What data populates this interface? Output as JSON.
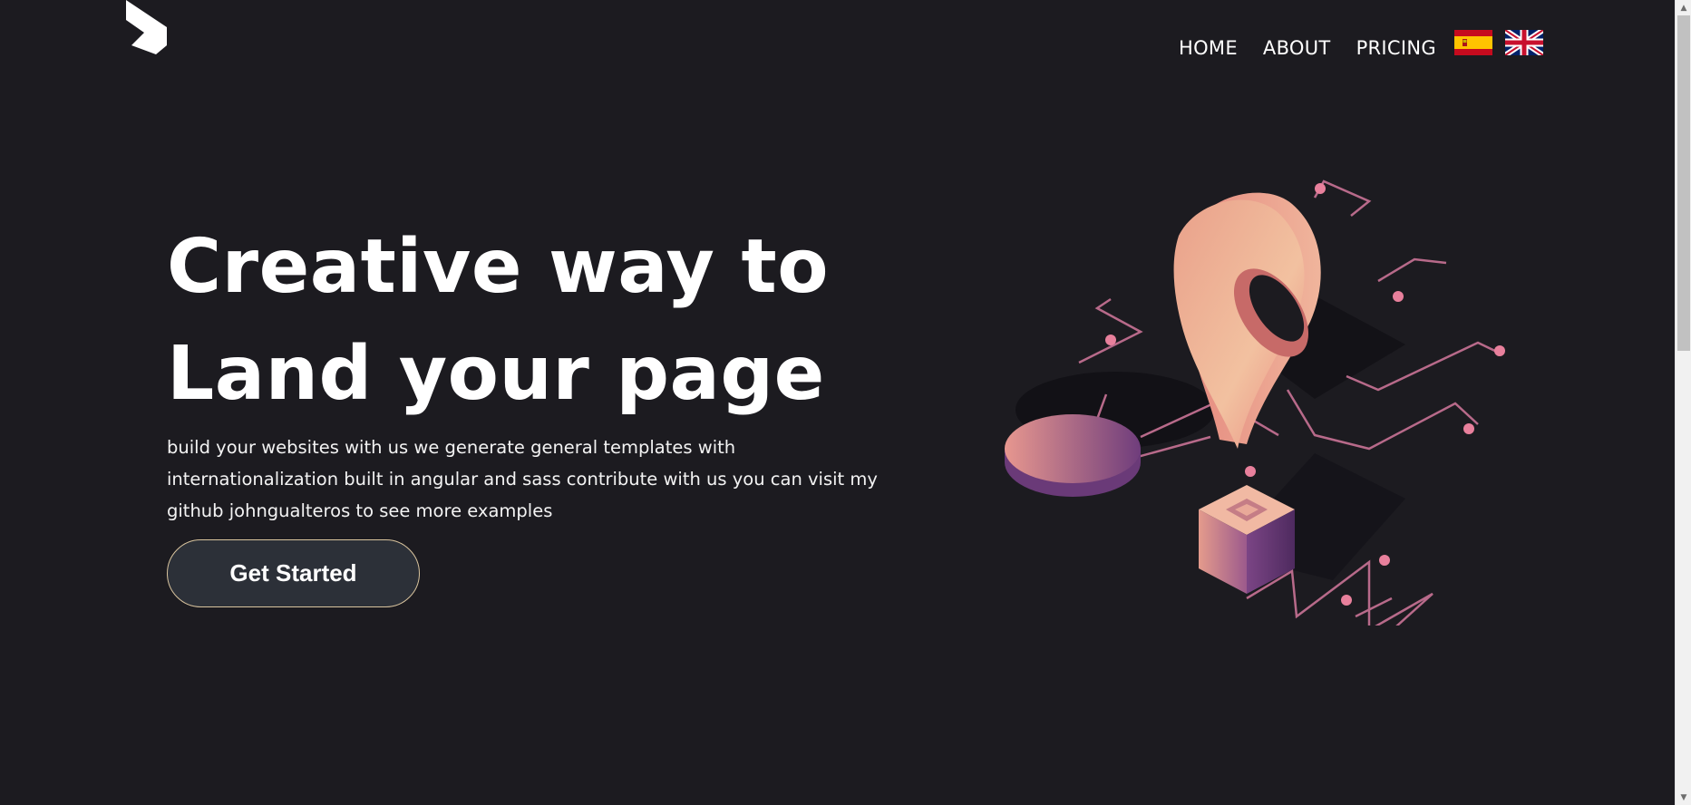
{
  "nav": {
    "links": [
      "HOME",
      "ABOUT",
      "PRICING"
    ],
    "flags": [
      "spain-flag-icon",
      "uk-flag-icon"
    ]
  },
  "hero": {
    "title_line1": "Creative way to",
    "title_line2": "Land your page",
    "description": "build your websites with us we generate general templates with internationalization built in angular and sass contribute with us you can visit my github johngualteros to see more examples",
    "cta_label": "Get Started"
  },
  "icons": {
    "logo": "brand-logo-icon",
    "illustration": "location-pin-illustration"
  },
  "colors": {
    "background": "#1c1b20",
    "accent_pink": "#e8857f",
    "accent_purple": "#6c3d7a",
    "cta_border": "#d9c49e",
    "cta_bg": "#2c3038"
  }
}
